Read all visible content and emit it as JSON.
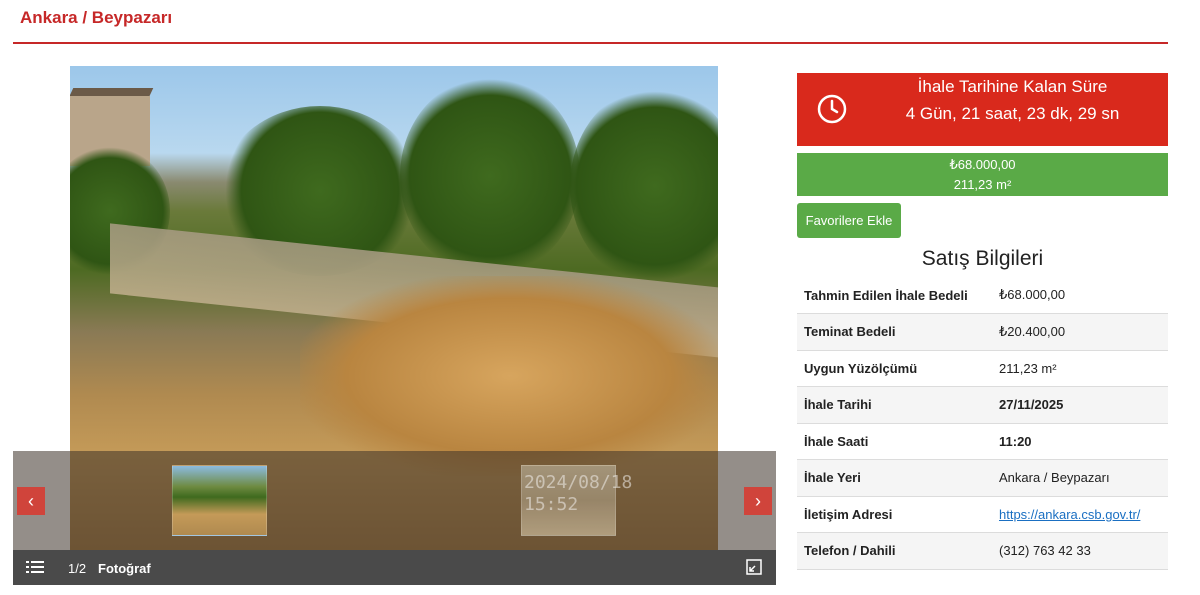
{
  "header": {
    "location": "Ankara / Beypazarı"
  },
  "gallery": {
    "prev_arrow": "‹",
    "next_arrow": "›",
    "thumb2_stamp_line1": "2024/08/18",
    "thumb2_stamp_line2": "15:52",
    "counter": "1/2",
    "counter_label": "Fotoğraf"
  },
  "countdown": {
    "title": "İhale Tarihine Kalan Süre",
    "remaining": "4 Gün, 21 saat, 23 dk, 29 sn",
    "icon": "clock-icon",
    "color": "#d9291c"
  },
  "price_box": {
    "price": "₺68.000,00",
    "area": "211,23 m²",
    "color": "#5aaa47"
  },
  "favorite_button": {
    "label": "Favorilere Ekle"
  },
  "sale_info": {
    "title": "Satış Bilgileri",
    "rows": [
      {
        "label": "Tahmin Edilen İhale Bedeli",
        "value": "₺68.000,00"
      },
      {
        "label": "Teminat Bedeli",
        "value": "₺20.400,00"
      },
      {
        "label": "Uygun Yüzölçümü",
        "value": "211,23 m²"
      },
      {
        "label": "İhale Tarihi",
        "value": "27/11/2025"
      },
      {
        "label": "İhale Saati",
        "value": "11:20"
      },
      {
        "label": "İhale Yeri",
        "value": "Ankara / Beypazarı"
      },
      {
        "label": "İletişim Adresi",
        "value": "https://ankara.csb.gov.tr/"
      },
      {
        "label": "Telefon / Dahili",
        "value": "(312) 763 42 33"
      }
    ]
  }
}
